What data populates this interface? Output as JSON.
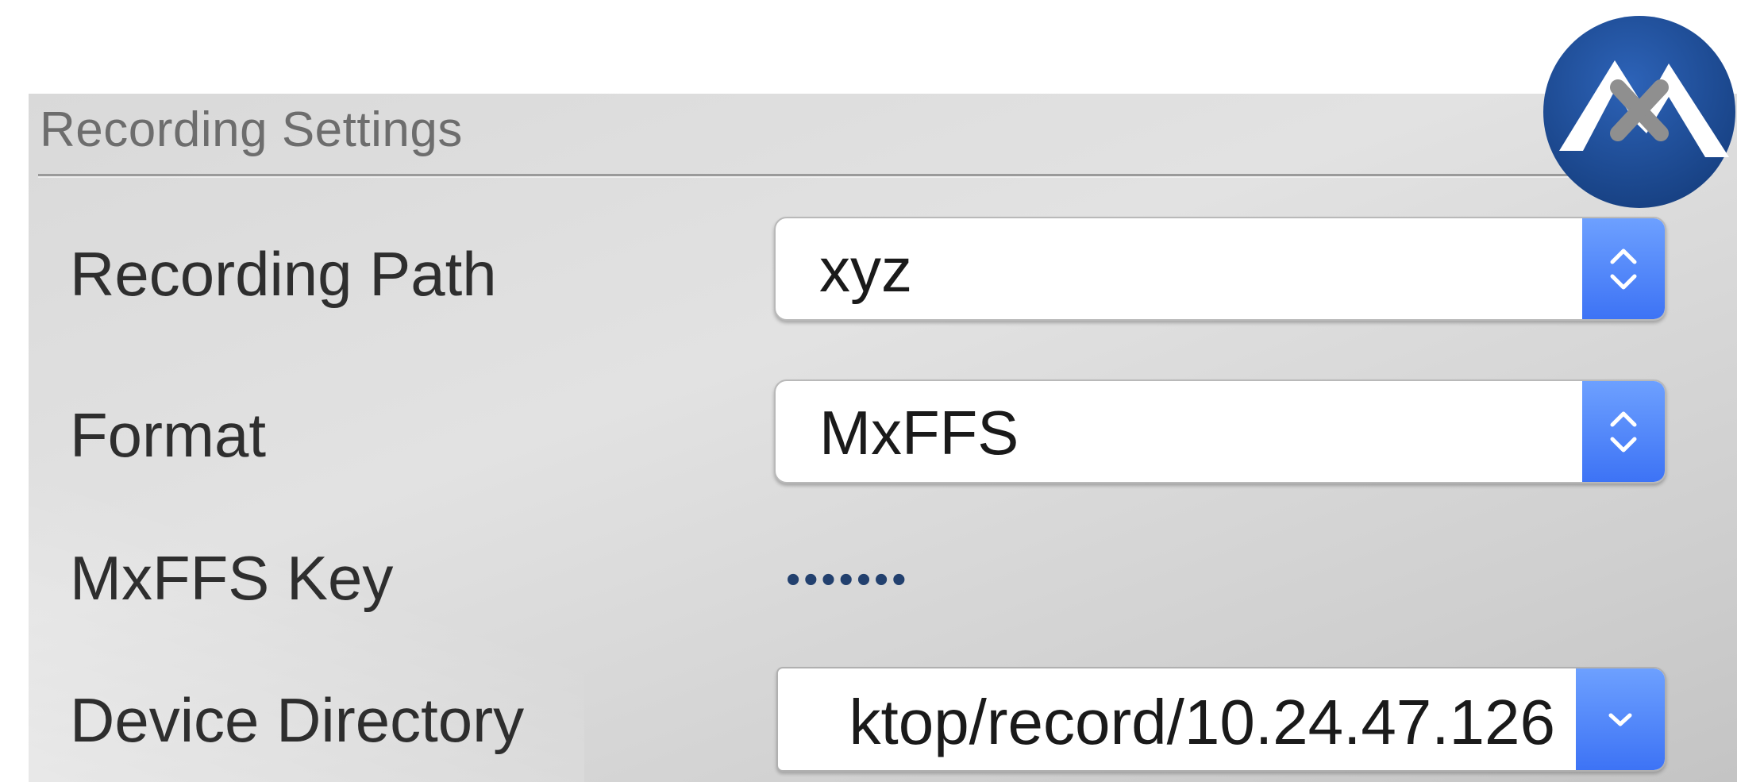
{
  "section": {
    "title": "Recording Settings"
  },
  "rows": {
    "recording_path": {
      "label": "Recording Path",
      "value": "xyz"
    },
    "format": {
      "label": "Format",
      "value": "MxFFS"
    },
    "mxffs_key": {
      "label": "MxFFS Key",
      "masked_value": "•••••••"
    },
    "device_directory": {
      "label": "Device Directory",
      "value": "ktop/record/10.24.47.126"
    }
  },
  "icons": {
    "logo": "mobotix-logo-icon",
    "stepper": "up-down-chevron-icon",
    "dropdown": "chevron-down-icon"
  },
  "colors": {
    "accent_blue": "#3d73f5",
    "logo_blue": "#1f4f9a",
    "panel_gray": "#d9d9d9"
  }
}
